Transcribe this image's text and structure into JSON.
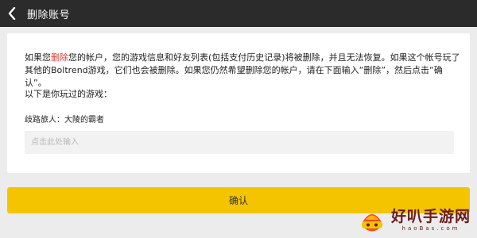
{
  "header": {
    "title": "删除账号"
  },
  "main": {
    "description_prefix": "如果您",
    "description_highlight": "删除",
    "description_suffix": "您的帐户，您的游戏信息和好友列表(包括支付历史记录)将被删除，并且无法恢复。如果这个帐号玩了其他的Boltrend游戏，它们也会被删除。如果您仍然希望删除您的帐户，请在下面输入“删除”，然后点击“确认”。",
    "played_label": "以下是你玩过的游戏：",
    "games": [
      "歧路旅人：大陵的霸者"
    ],
    "input_placeholder": "点击此处输入",
    "input_value": ""
  },
  "confirm_label": "确认",
  "watermark": {
    "text": "好叭手游网",
    "url": "haoBas.com"
  },
  "colors": {
    "topbar": "#2b2b2b",
    "highlight": "#e23b2e",
    "confirm": "#f5c400",
    "watermark": "#6b1c1c"
  }
}
